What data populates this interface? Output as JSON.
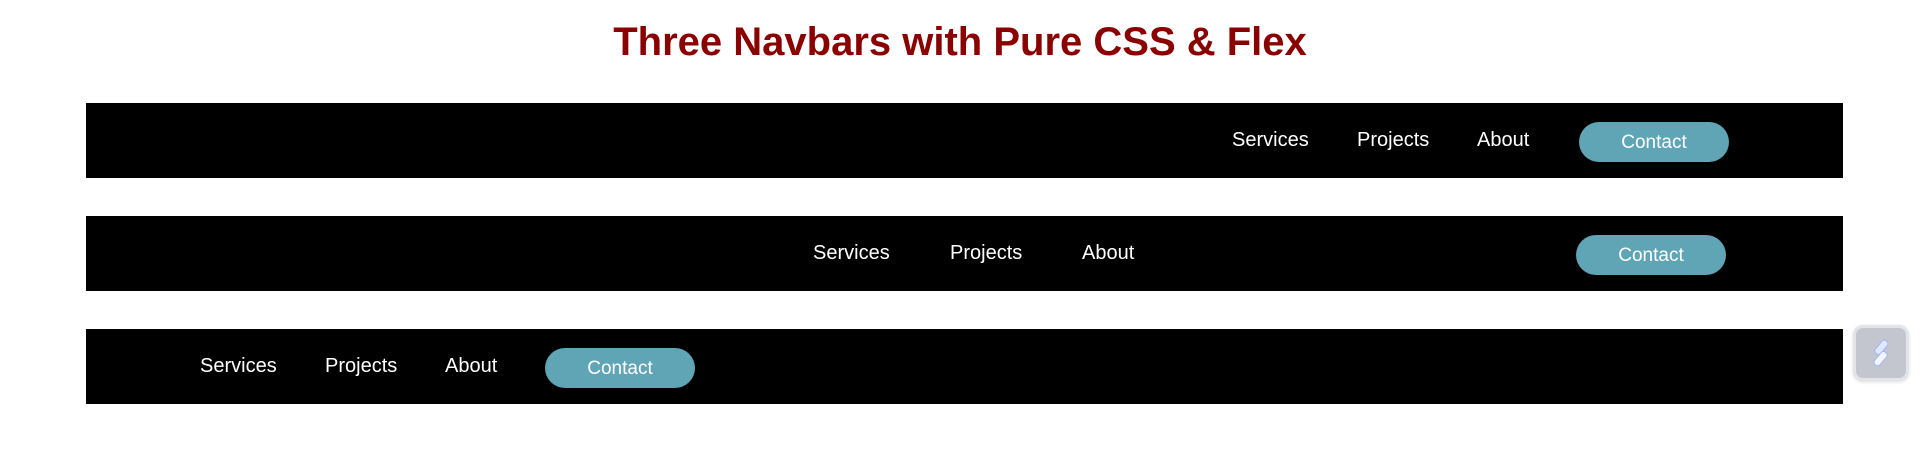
{
  "page": {
    "title": "Three Navbars with Pure CSS & Flex"
  },
  "colors": {
    "title": "#8b0000",
    "navbar_bg": "#000000",
    "link_text": "#ffffff",
    "contact_bg": "#5fa5b5"
  },
  "navbars": [
    {
      "alignment": "right",
      "links": [
        "Services",
        "Projects",
        "About"
      ],
      "contact_label": "Contact"
    },
    {
      "alignment": "center",
      "links": [
        "Services",
        "Projects",
        "About"
      ],
      "contact_label": "Contact"
    },
    {
      "alignment": "left",
      "links": [
        "Services",
        "Projects",
        "About"
      ],
      "contact_label": "Contact"
    }
  ],
  "widget": {
    "icon": "pen-icon"
  }
}
